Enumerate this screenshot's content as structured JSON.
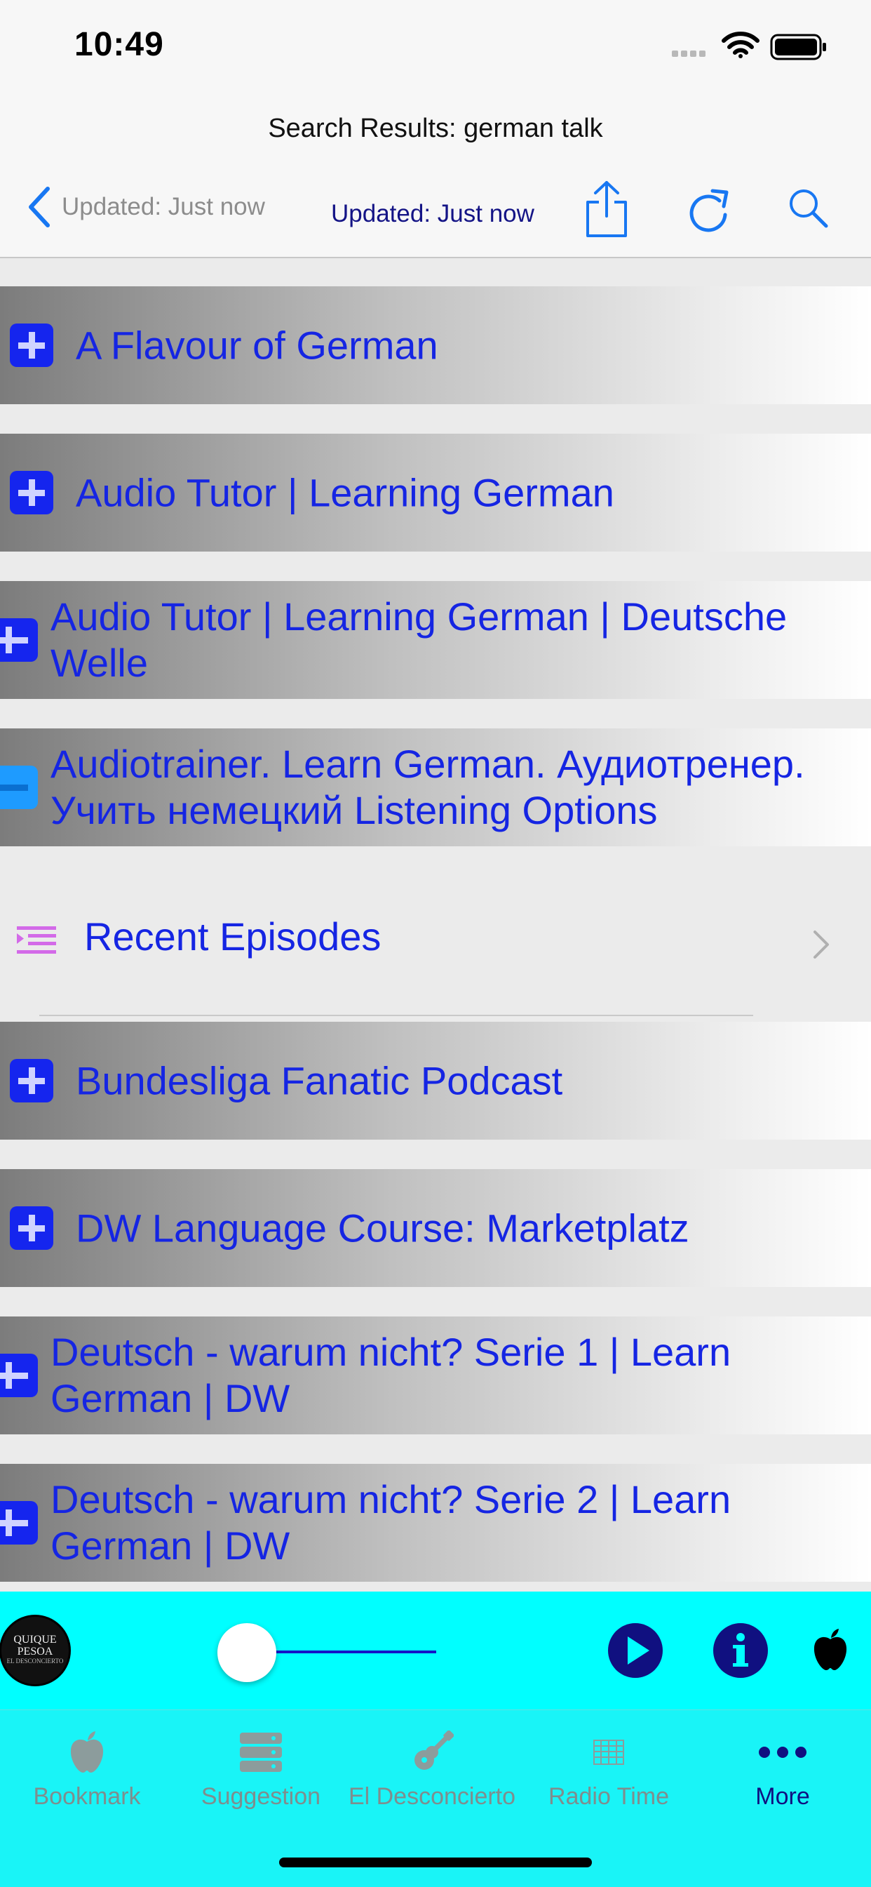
{
  "status_bar": {
    "time": "10:49"
  },
  "nav": {
    "title": "Search Results: german talk",
    "back_label": "Updated: Just now",
    "updated_label": "Updated: Just now"
  },
  "results": [
    {
      "title": "A Flavour of German",
      "expanded": false
    },
    {
      "title": "Audio Tutor | Learning German",
      "expanded": false
    },
    {
      "title": "Audio Tutor | Learning German | Deutsche Welle",
      "expanded": false
    },
    {
      "title": "Audiotrainer. Learn German. Аудиотренер. Учить немецкий Listening Options",
      "expanded": true
    },
    {
      "title": "Bundesliga Fanatic Podcast",
      "expanded": false
    },
    {
      "title": "DW Language Course: Marketplatz",
      "expanded": false
    },
    {
      "title": "Deutsch - warum nicht? Serie 1 | Learn German | DW",
      "expanded": false
    },
    {
      "title": "Deutsch - warum nicht? Serie 2 | Learn German | DW",
      "expanded": false
    }
  ],
  "expanded_submenu": {
    "label": "Recent Episodes",
    "icon": "list-icon",
    "chevron": "chevron-right-icon"
  },
  "player": {
    "artwork_text_1": "QUIQUE PESOA",
    "artwork_text_2": "EL DESCONCIERTO",
    "progress": 0.0,
    "buttons": [
      "play-icon",
      "info-icon",
      "apple-icon"
    ]
  },
  "tabs": [
    {
      "label": "Bookmark",
      "icon": "apple-icon",
      "active": false
    },
    {
      "label": "Suggestion",
      "icon": "server-icon",
      "active": false
    },
    {
      "label": "El Desconcierto",
      "icon": "guitar-icon",
      "active": false
    },
    {
      "label": "Radio Time",
      "icon": "grid-icon",
      "active": false
    },
    {
      "label": "More",
      "icon": "more-icon",
      "active": true
    }
  ],
  "colors": {
    "accent_blue": "#1525e3",
    "nav_blue": "#1877f2",
    "player_bg": "#00ffff",
    "tabbar_bg": "#19f4f7",
    "active_tab": "#101080"
  }
}
